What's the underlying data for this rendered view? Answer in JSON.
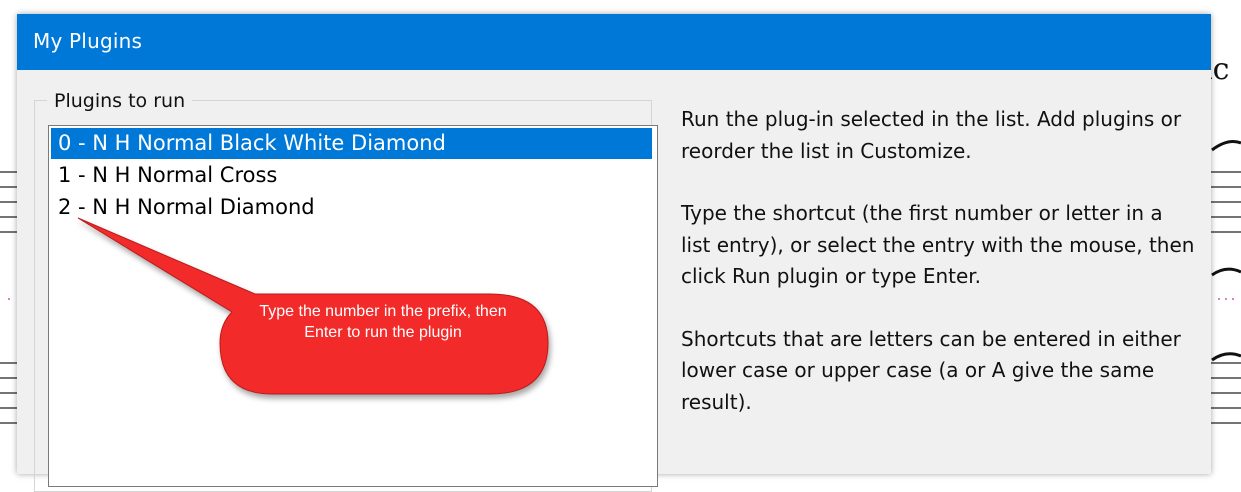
{
  "background": {
    "partial_text": "ic"
  },
  "dialog": {
    "title": "My Plugins",
    "group_label": "Plugins to run",
    "plugins": [
      {
        "label": "0 - N H Normal Black White Diamond",
        "selected": true
      },
      {
        "label": "1 - N H Normal Cross",
        "selected": false
      },
      {
        "label": "2 - N H Normal Diamond",
        "selected": false
      }
    ],
    "description": [
      "Run the  plug-in selected in the list. Add plugins or reorder the list in Customize.",
      "Type the shortcut (the first number or letter in a list entry), or select the entry with the mouse, then click Run plugin or type Enter.",
      "Shortcuts that are letters can be entered in either lower case or upper case (a or A give the same result)."
    ]
  },
  "callout": {
    "text": "Type the number in the prefix, then Enter to run the plugin",
    "color": "#f22a2a"
  },
  "colors": {
    "accent": "#0078d7",
    "dialog_bg": "#f0f0f0"
  }
}
